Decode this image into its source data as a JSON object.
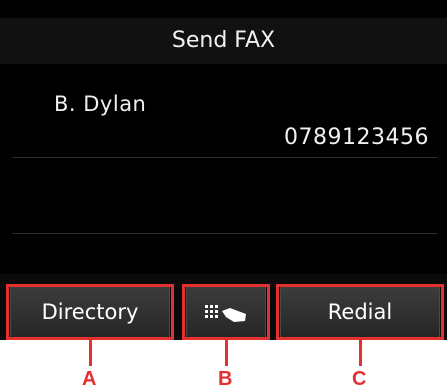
{
  "screen": {
    "title": "Send FAX",
    "entry": {
      "name": "B. Dylan",
      "number": "0789123456"
    }
  },
  "buttons": {
    "directory_label": "Directory",
    "keypad_icon": "keypad-icon",
    "redial_label": "Redial"
  },
  "callouts": [
    "A",
    "B",
    "C"
  ],
  "colors": {
    "callout": "#e53030",
    "screen_bg": "#000000",
    "button_bg": "#333333"
  }
}
